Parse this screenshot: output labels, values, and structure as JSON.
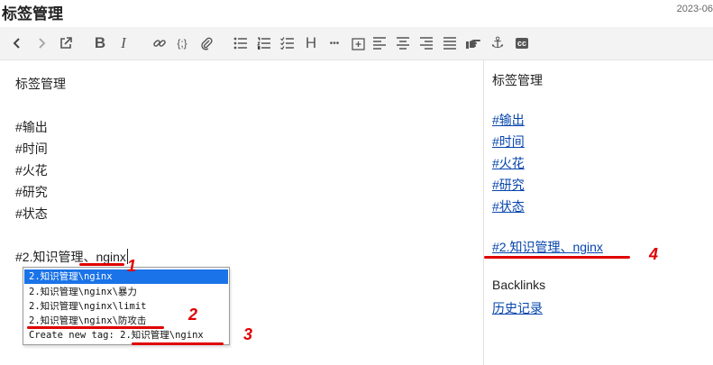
{
  "header": {
    "title": "标签管理",
    "date": "2023-06"
  },
  "toolbar": {
    "buttons": [
      {
        "name": "back-button",
        "icon": "chevron-left-icon"
      },
      {
        "name": "forward-button",
        "icon": "chevron-right-icon"
      },
      {
        "name": "open-external-button",
        "icon": "external-link-icon"
      },
      {
        "name": "bold-button",
        "icon": "bold-icon",
        "label": "B"
      },
      {
        "name": "italic-button",
        "icon": "italic-icon",
        "label": "I"
      },
      {
        "name": "link-button",
        "icon": "link-icon"
      },
      {
        "name": "code-button",
        "icon": "code-braces-icon",
        "label": "{;}"
      },
      {
        "name": "attach-button",
        "icon": "paperclip-icon"
      },
      {
        "name": "bullet-list-button",
        "icon": "bullet-list-icon"
      },
      {
        "name": "numbered-list-button",
        "icon": "numbered-list-icon"
      },
      {
        "name": "checklist-button",
        "icon": "checklist-icon"
      },
      {
        "name": "heading-button",
        "icon": "heading-icon",
        "label": "H"
      },
      {
        "name": "more-button",
        "icon": "more-dots-icon",
        "label": "•••"
      },
      {
        "name": "insert-date-button",
        "icon": "calendar-plus-icon"
      },
      {
        "name": "align-left-button",
        "icon": "align-left-icon"
      },
      {
        "name": "align-center-button",
        "icon": "align-center-icon"
      },
      {
        "name": "align-right-button",
        "icon": "align-right-icon"
      },
      {
        "name": "align-justify-button",
        "icon": "align-justify-icon"
      },
      {
        "name": "hand-button",
        "icon": "pointing-hand-icon"
      },
      {
        "name": "anchor-button",
        "icon": "anchor-icon",
        "label": "⚓"
      },
      {
        "name": "cc-button",
        "icon": "cc-icon",
        "label": "cc"
      }
    ]
  },
  "editor": {
    "title_line": "标签管理",
    "tags": [
      "#输出",
      "#时间",
      "#火花",
      "#研究",
      "#状态"
    ],
    "current_line": "#2.知识管理、nginx"
  },
  "autocomplete": {
    "options": [
      "2.知识管理\\nginx",
      "2.知识管理\\nginx\\暴力",
      "2.知识管理\\nginx\\limit",
      "2.知识管理\\nginx\\防攻击",
      "Create new tag: 2.知识管理\\nginx"
    ],
    "selected_index": 0
  },
  "preview": {
    "title": "标签管理",
    "tags": [
      "#输出",
      "#时间",
      "#火花",
      "#研究",
      "#状态"
    ],
    "current_tag": "#2.知识管理、nginx",
    "backlinks_heading": "Backlinks",
    "backlinks": [
      "历史记录"
    ]
  },
  "annotations": {
    "markers": [
      "1",
      "2",
      "3",
      "4"
    ],
    "color": "#e00000"
  },
  "colors": {
    "link": "#0645ad",
    "selection": "#1a73e8",
    "toolbar_bg": "#f3f3f3"
  }
}
